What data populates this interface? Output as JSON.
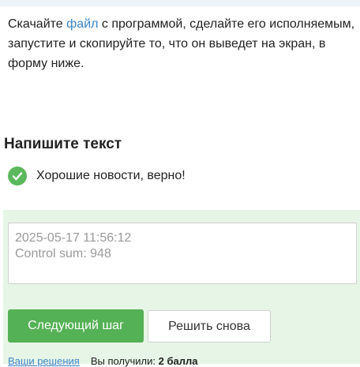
{
  "intro": {
    "text_before_link": "Скачайте ",
    "link_text": "файл",
    "line1_rest": " с программой, сделайте его исполняемым,",
    "line2": "запустите и скопируйте то, что он выведет на экран, в",
    "line3": "форму ниже."
  },
  "heading": "Напишите текст",
  "feedback": {
    "icon": "check-circle-icon",
    "message": "Хорошие новости, верно!",
    "color": "#5cb85c"
  },
  "answer": {
    "value": "2025-05-17 11:56:12\nControl sum: 948"
  },
  "buttons": {
    "next_label": "Следующий шаг",
    "retry_label": "Решить снова",
    "accent": "#55b155"
  },
  "footer": {
    "solutions_link": "Ваши решения",
    "score_label": "Вы получили: ",
    "score_value": "2 балла"
  }
}
